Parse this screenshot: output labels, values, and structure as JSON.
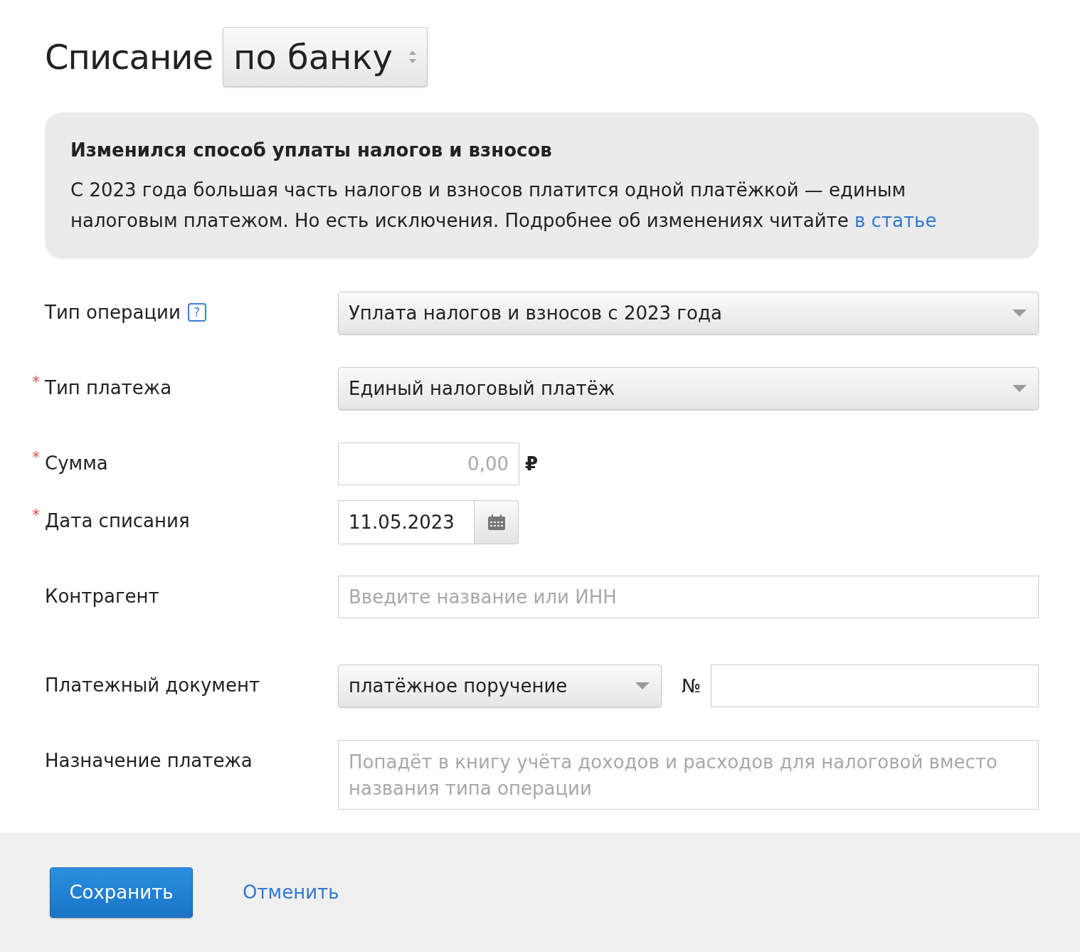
{
  "header": {
    "title": "Списание",
    "mode_select": {
      "value": "по банку"
    }
  },
  "notice": {
    "title": "Изменился способ уплаты налогов и взносов",
    "text": "С 2023 года большая часть налогов и взносов платится одной платёжкой — единым налоговым платежом. Но есть исключения. Подробнее об изменениях читайте",
    "link": "в статье"
  },
  "fields": [
    {
      "kind": "select",
      "label": "Тип операции",
      "help": "?",
      "value": "Уплата налогов и взносов с 2023 года"
    },
    {
      "kind": "select",
      "label": "Тип платежа",
      "required_mark": "*",
      "value": "Единый налоговый платёж"
    },
    {
      "kind": "amount",
      "label": "Сумма",
      "required_mark": "*",
      "placeholder": "0,00",
      "currency": "₽"
    },
    {
      "kind": "date",
      "label": "Дата списания",
      "required_mark": "*",
      "value": "11.05.2023"
    },
    {
      "kind": "text",
      "label": "Контрагент",
      "placeholder": "Введите название или ИНН"
    },
    {
      "kind": "document",
      "label": "Платежный документ",
      "value": "платёжное поручение",
      "number_label": "№"
    },
    {
      "kind": "textarea",
      "label": "Назначение платежа",
      "placeholder": "Попадёт в книгу учёта доходов и расходов для налоговой вместо названия типа операции"
    }
  ],
  "footer": {
    "save": "Сохранить",
    "cancel": "Отменить"
  }
}
